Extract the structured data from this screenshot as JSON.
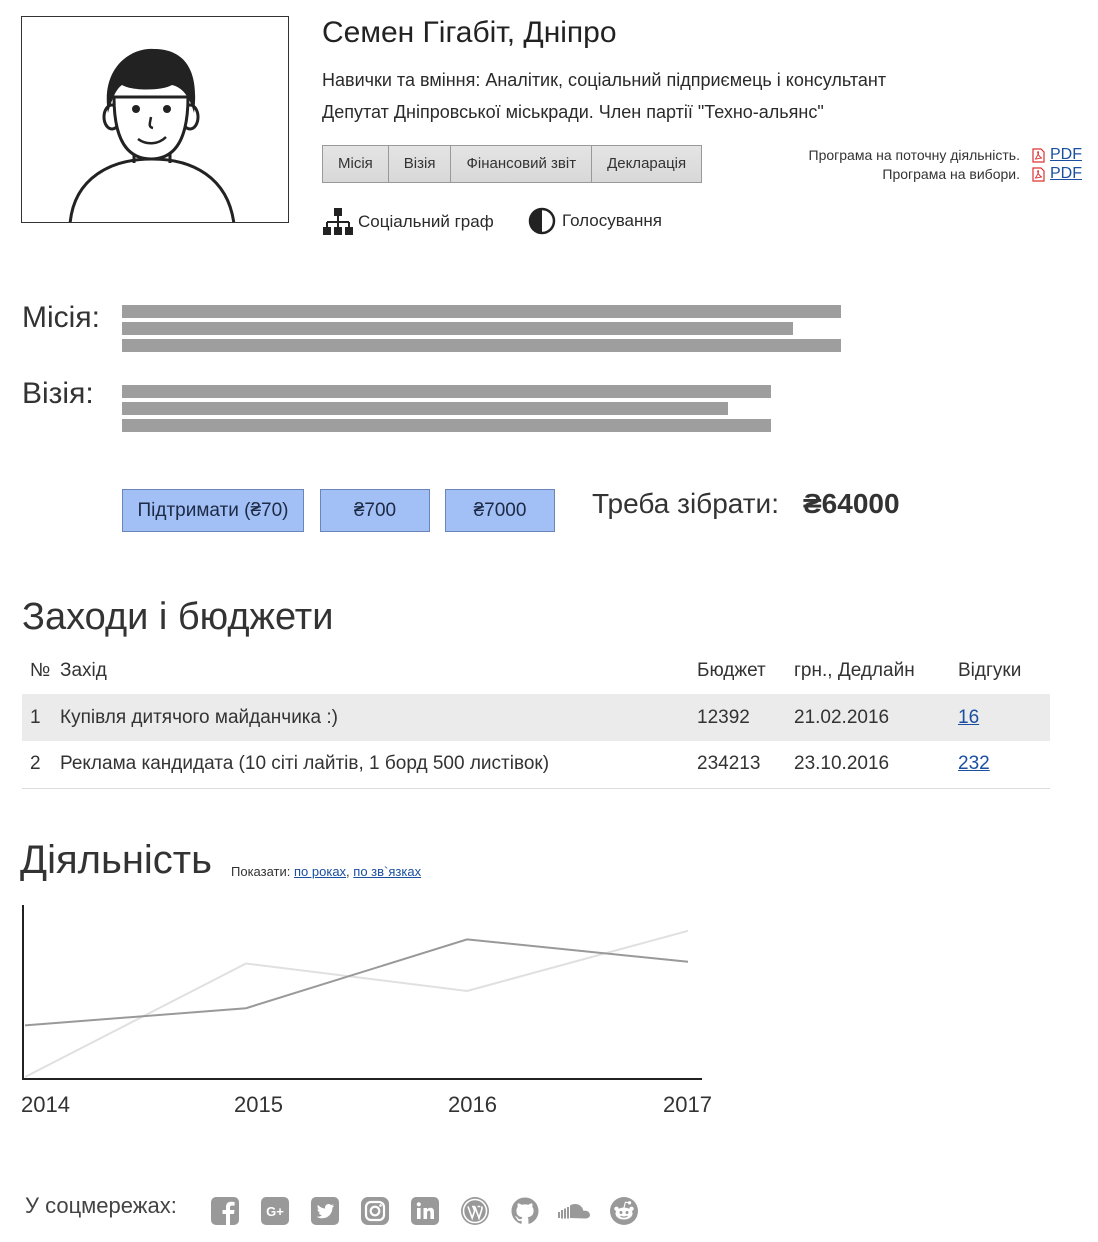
{
  "profile": {
    "name": "Семен Гігабіт, Дніпро",
    "skills": "Навички та вміння: Аналітик, соціальний підприємець і консультант",
    "position": "Депутат Дніпровської міськради. Член партії \"Техно-альянс\""
  },
  "tabs": [
    "Місія",
    "Візія",
    "Фінансовий звіт",
    "Декларація"
  ],
  "programs": [
    {
      "label": "Програма на поточну діяльність.",
      "link": "PDF"
    },
    {
      "label": "Програма на вибори.",
      "link": "PDF"
    }
  ],
  "actions": {
    "social_graph": "Соціальний граф",
    "voting": "Голосування"
  },
  "mission": {
    "label": "Місія:"
  },
  "vision": {
    "label": "Візія:"
  },
  "support": {
    "buttons": [
      "Підтримати (₴70)",
      "₴700",
      "₴7000"
    ],
    "raise_label": "Треба зібрати:",
    "raise_value": "₴64000"
  },
  "events": {
    "title": "Заходи і бюджети",
    "headers": {
      "no": "№",
      "event": "Захід",
      "budget": "Бюджет",
      "deadline": "грн., Дедлайн",
      "reviews": "Відгуки"
    },
    "rows": [
      {
        "no": "1",
        "event": "Купівля дитячого майданчика :)",
        "budget": "12392",
        "deadline": "21.02.2016",
        "reviews": "16"
      },
      {
        "no": "2",
        "event": "Реклама кандидата (10 сіті лайтів, 1 борд 500 листівок)",
        "budget": "234213",
        "deadline": "23.10.2016",
        "reviews": "232"
      }
    ]
  },
  "activity": {
    "title": "Діяльність",
    "show_by_label": "Показати:",
    "show_by_years": "по роках",
    "show_by_sep": ",",
    "show_by_links": "по зв`язках"
  },
  "chart_data": {
    "type": "line",
    "x": [
      "2014",
      "2015",
      "2016",
      "2017"
    ],
    "series": [
      {
        "values": [
          0.3,
          0.4,
          0.8,
          0.67
        ],
        "color": "#999999"
      },
      {
        "values": [
          0.0,
          0.66,
          0.5,
          0.85
        ],
        "color": "#e0e0e0"
      }
    ],
    "ylim": [
      0,
      1
    ],
    "grid": false
  },
  "social": {
    "label": "У соцмережах:",
    "icons": [
      "facebook-icon",
      "google-plus-icon",
      "twitter-icon",
      "instagram-icon",
      "linkedin-icon",
      "wordpress-icon",
      "github-icon",
      "soundcloud-icon",
      "reddit-icon"
    ],
    "color": "#999999"
  }
}
